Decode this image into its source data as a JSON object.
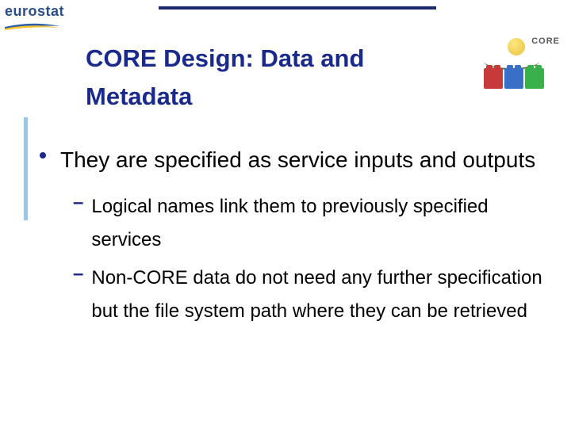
{
  "logo": {
    "text": "eurostat"
  },
  "core": {
    "label": "CORE"
  },
  "title": "CORE Design: Data and Metadata",
  "bullets": {
    "l1": "They are specified as service inputs and outputs",
    "l2a": "Logical names link them to previously specified services",
    "l2b": "Non-CORE data do not need any further specification but the file system path where they can be retrieved"
  }
}
